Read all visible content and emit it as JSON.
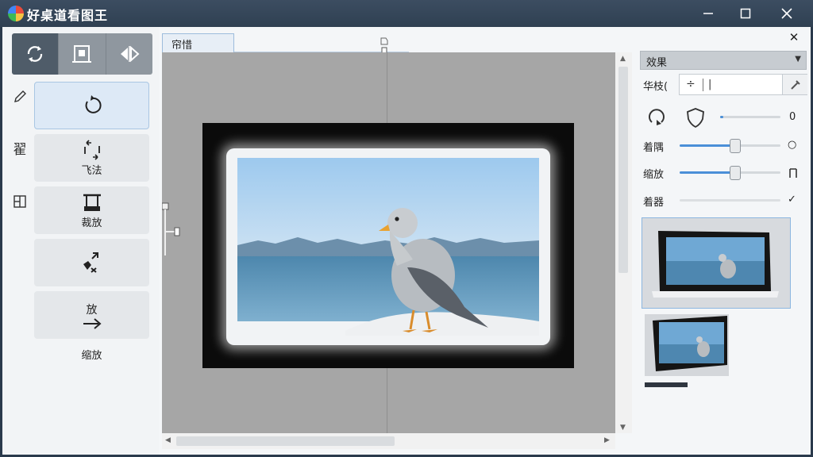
{
  "window": {
    "title": "好桌道看图王",
    "buttons": {
      "minimize": "—",
      "maximize": "☐",
      "close": "✕"
    }
  },
  "left_panel": {
    "top_tabs": [
      {
        "icon": "rotate-icon",
        "active": true
      },
      {
        "icon": "portrait-frame-icon",
        "active": false
      },
      {
        "icon": "flip-icon",
        "active": false
      }
    ],
    "side_icons": [
      {
        "icon": "pencil-icon"
      },
      {
        "icon": "text-label-icon",
        "text": "翟"
      },
      {
        "icon": "layout-icon"
      }
    ],
    "tools": [
      {
        "icon": "rotate-icon",
        "label": "",
        "active": true
      },
      {
        "icon": "flip-arrows-icon",
        "label": "飞法"
      },
      {
        "icon": "crop-icon",
        "label": "裁放"
      },
      {
        "icon": "transform-icon",
        "label": ""
      },
      {
        "icon": "arrow-icon",
        "label": "放"
      }
    ],
    "zoom_label": "缩放"
  },
  "canvas": {
    "tab_label": "帘惜"
  },
  "right_panel": {
    "close": "✕",
    "dropdown": {
      "label": "效果"
    },
    "input_row": {
      "label": "华枝(",
      "symbol": "÷",
      "value": "|"
    },
    "sliders": [
      {
        "label": "",
        "value": 0.05,
        "end_label": "0"
      },
      {
        "label": "着隅",
        "value": 0.55,
        "end_label": "○"
      },
      {
        "label": "缩放",
        "value": 0.55,
        "end_label": ""
      },
      {
        "label": "着器",
        "value": 1.0,
        "end_label": "✓"
      }
    ]
  },
  "colors": {
    "title_bar": "#2f4052",
    "accent": "#4a8fd8",
    "canvas_bg": "#a6a6a6",
    "tab_active": "#4f5c69"
  }
}
